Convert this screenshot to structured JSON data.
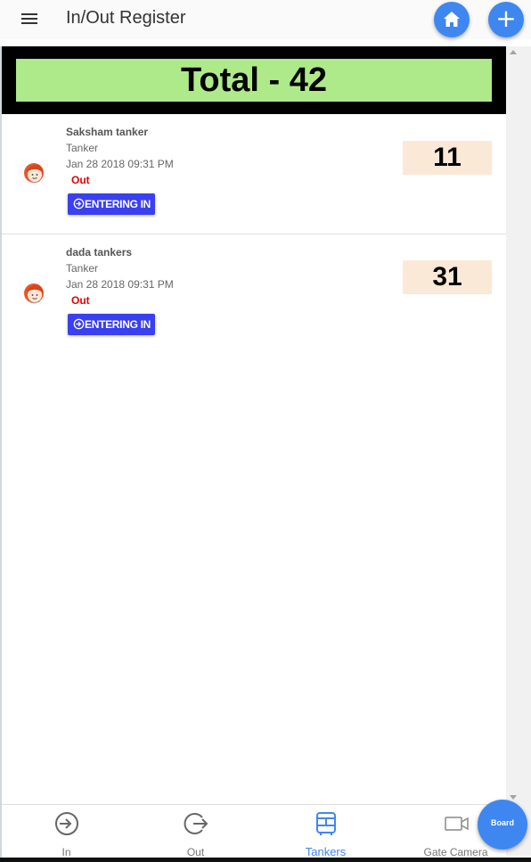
{
  "header": {
    "title": "In/Out Register",
    "menu_icon": "hamburger-menu-icon",
    "home_icon": "home-icon",
    "add_label": "+"
  },
  "total": {
    "label": "Total - 42"
  },
  "records": [
    {
      "name": "Saksham tanker",
      "type": "Tanker",
      "datetime": "Jan 28 2018 09:31 PM",
      "status": "Out",
      "action_label": "ENTERING IN",
      "count": "11"
    },
    {
      "name": "dada tankers",
      "type": "Tanker",
      "datetime": "Jan 28 2018 09:31 PM",
      "status": "Out",
      "action_label": "ENTERING IN",
      "count": "31"
    }
  ],
  "bottom_nav": {
    "items": [
      {
        "label": "In",
        "icon": "login-icon"
      },
      {
        "label": "Out",
        "icon": "logout-icon"
      },
      {
        "label": "Tankers",
        "icon": "bus-icon",
        "active": true
      },
      {
        "label": "Gate Camera",
        "icon": "video-camera-icon"
      }
    ],
    "board_label": "Board"
  },
  "colors": {
    "accent": "#3f87f0",
    "total_bg": "#aeea8a",
    "count_bg": "#fbe9d7",
    "button": "#3a3ff0",
    "status_out": "#e00000"
  }
}
